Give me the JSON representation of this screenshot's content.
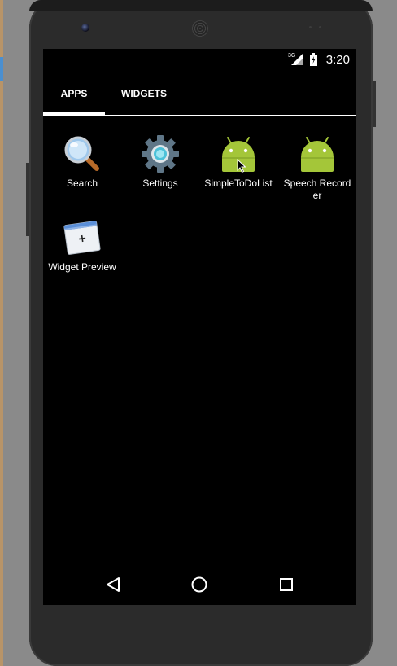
{
  "status_bar": {
    "time": "3:20",
    "network_label": "3G",
    "icons": [
      "signal-icon",
      "battery-icon"
    ]
  },
  "tabs": [
    {
      "label": "APPS",
      "selected": true
    },
    {
      "label": "WIDGETS",
      "selected": false
    }
  ],
  "apps": [
    {
      "label": "Search",
      "icon": "search-icon"
    },
    {
      "label": "Settings",
      "icon": "settings-icon"
    },
    {
      "label": "SimpleToDoList",
      "icon": "android-icon"
    },
    {
      "label": "Speech Recorder",
      "icon": "android-icon"
    },
    {
      "label": "Widget Preview",
      "icon": "widget-preview-icon"
    }
  ],
  "nav_bar": {
    "icons": [
      "back-icon",
      "home-icon",
      "recents-icon"
    ]
  },
  "colors": {
    "android_green": "#a4c639",
    "screen_bg": "#000000",
    "device_body": "#2b2b2b"
  }
}
